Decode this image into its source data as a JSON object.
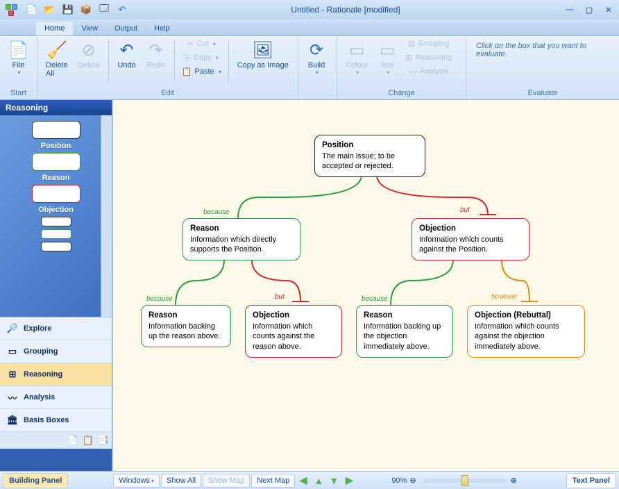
{
  "title": "Untitled - Rationale [modified]",
  "menu_tabs": [
    "Home",
    "View",
    "Output",
    "Help"
  ],
  "ribbon": {
    "start": {
      "file": "File",
      "label": "Start"
    },
    "edit": {
      "label": "Edit",
      "delete_all": "Delete\nAll",
      "delete": "Delete",
      "undo": "Undo",
      "redo": "Redo",
      "cut": "Cut",
      "copy": "Copy",
      "paste": "Paste",
      "copyimg": "Copy as Image"
    },
    "build": {
      "label": "",
      "build": "Build"
    },
    "change": {
      "label": "Change",
      "colour": "Colour",
      "box": "Box",
      "grouping": "Grouping",
      "reasoning": "Reasoning",
      "analysis": "Analysis"
    },
    "evaluate": {
      "label": "Evaluate",
      "hint": "Click on the box that you want to evaluate."
    }
  },
  "sidebar": {
    "title": "Reasoning",
    "shapes": [
      "Position",
      "Reason",
      "Objection"
    ],
    "accordion": [
      {
        "icon": "🔎",
        "label": "Explore"
      },
      {
        "icon": "▭",
        "label": "Grouping"
      },
      {
        "icon": "⊞",
        "label": "Reasoning",
        "active": true
      },
      {
        "icon": "〰",
        "label": "Analysis"
      },
      {
        "icon": "🏛",
        "label": "Basis Boxes"
      }
    ]
  },
  "canvas": {
    "nodes": {
      "pos": {
        "t": "Position",
        "d": "The main issue; to be accepted or rejected."
      },
      "rea1": {
        "t": "Reason",
        "d": "Information which directly supports the Position."
      },
      "obj1": {
        "t": "Objection",
        "d": "Information which counts against the Position."
      },
      "rea2": {
        "t": "Reason",
        "d": "Information backing up the reason above."
      },
      "obj2": {
        "t": "Objection",
        "d": "Information which counts against the reason above."
      },
      "rea3": {
        "t": "Reason",
        "d": "Information backing up the objection immediately above."
      },
      "obj3": {
        "t": "Objection (Rebuttal)",
        "d": "Information which counts against the objection immediately above."
      }
    },
    "labels": {
      "because": "because",
      "but": "but",
      "however": "however"
    }
  },
  "status": {
    "building": "Building Panel",
    "windows": "Windows",
    "showall": "Show All",
    "showmap": "Show Map",
    "nextmap": "Next Map",
    "zoom": "90%",
    "textpanel": "Text Panel"
  }
}
